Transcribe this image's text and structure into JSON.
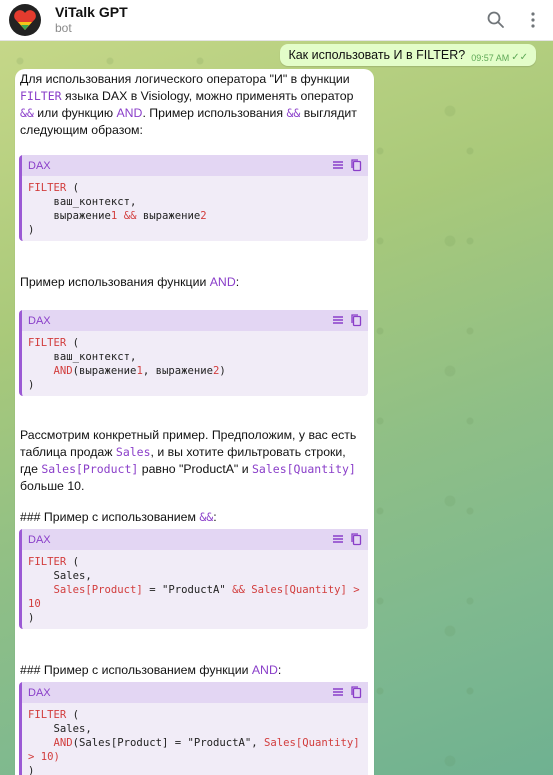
{
  "header": {
    "title": "ViTalk GPT",
    "subtitle": "bot"
  },
  "outgoing": {
    "text": "Как использовать И в FILTER?",
    "time": "09:57 AM"
  },
  "incoming": {
    "intro_1": "Для использования логического оператора \"И\" в функции ",
    "intro_kw_filter": "FILTER",
    "intro_2": " языка DAX в Visiology, можно применять оператор ",
    "intro_kw_amp": "&&",
    "intro_3": " или функцию ",
    "intro_kw_and": "AND",
    "intro_4": ". Пример использования ",
    "intro_kw_amp2": "&&",
    "intro_5": " выглядит следующим образом:",
    "code1": {
      "lang": "DAX",
      "l1_kw": "FILTER",
      "l1_rest": " (",
      "l2": "    ваш_контекст,",
      "l3_a": "    выражение",
      "l3_n1": "1",
      "l3_op": " && ",
      "l3_b": "выражение",
      "l3_n2": "2",
      "l4": ")"
    },
    "and_intro_1": "Пример использования функции ",
    "and_intro_kw": "AND",
    "and_intro_2": ":",
    "code2": {
      "lang": "DAX",
      "l1_kw": "FILTER",
      "l1_rest": " (",
      "l2": "    ваш_контекст,",
      "l3_kw": "    AND",
      "l3_a": "(выражение",
      "l3_n1": "1",
      "l3_b": ", выражение",
      "l3_n2": "2",
      "l3_c": ")",
      "l4": ")"
    },
    "example_1": "Рассмотрим конкретный пример. Предположим, у вас есть таблица продаж ",
    "example_kw_sales": "Sales",
    "example_2": ", и вы хотите фильтровать строки, где ",
    "example_kw_prod": "Sales[Product]",
    "example_3": " равно \"ProductA\" и ",
    "example_kw_qty": "Sales[Quantity]",
    "example_4": " больше 10.",
    "heading_amp_1": "### Пример с использованием ",
    "heading_amp_kw": "&&",
    "heading_amp_2": ":",
    "code3": {
      "lang": "DAX",
      "l1_kw": "FILTER",
      "l1_rest": " (",
      "l2": "    Sales,",
      "l3_a": "    Sales[Product]",
      "l3_b": " = \"ProductA\" ",
      "l3_op": "&&",
      "l3_c": " Sales[Quantity] >",
      "l4": "10",
      "l5": ")"
    },
    "heading_and_1": "### Пример с использованием функции ",
    "heading_and_kw": "AND",
    "heading_and_2": ":",
    "code4": {
      "lang": "DAX",
      "l1_kw": "FILTER",
      "l1_rest": " (",
      "l2": "    Sales,",
      "l3_kw": "    AND",
      "l3_a": "(Sales[Product]",
      "l3_b": " = \"ProductA\", ",
      "l3_c": "Sales[Quantity]",
      "l4": "> 10)",
      "l5": ")"
    }
  }
}
